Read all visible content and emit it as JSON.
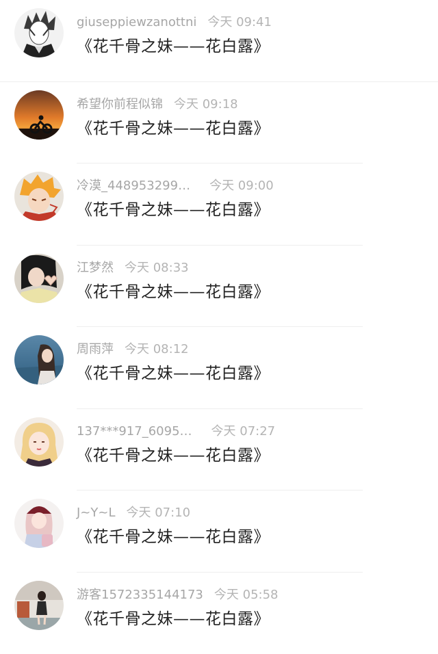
{
  "comments": [
    {
      "user": "giuseppiewzanottni",
      "time": "今天 09:41",
      "text": "《花千骨之妹——花白露》",
      "avatar": "anime-character-avatar"
    },
    {
      "user": "希望你前程似锦",
      "time": "今天 09:18",
      "text": "《花千骨之妹——花白露》",
      "avatar": "sunset-motorcycle-avatar"
    },
    {
      "user": "冷漠_448953299…",
      "time": "今天 09:00",
      "text": "《花千骨之妹——花白露》",
      "avatar": "anime-boy-avatar"
    },
    {
      "user": "江梦然",
      "time": "今天 08:33",
      "text": "《花千骨之妹——花白露》",
      "avatar": "girl-heart-hands-avatar"
    },
    {
      "user": "周雨萍",
      "time": "今天 08:12",
      "text": "《花千骨之妹——花白露》",
      "avatar": "girl-seaside-avatar"
    },
    {
      "user": "137***917_6095…",
      "time": "今天 07:27",
      "text": "《花千骨之妹——花白露》",
      "avatar": "blonde-girl-avatar"
    },
    {
      "user": "J~Y~L",
      "time": "今天 07:10",
      "text": "《花千骨之妹——花白露》",
      "avatar": "girl-cap-backpack-avatar"
    },
    {
      "user": "游客1572335144173",
      "time": "今天 05:58",
      "text": "《花千骨之妹——花白露》",
      "avatar": "girl-standing-avatar"
    }
  ]
}
